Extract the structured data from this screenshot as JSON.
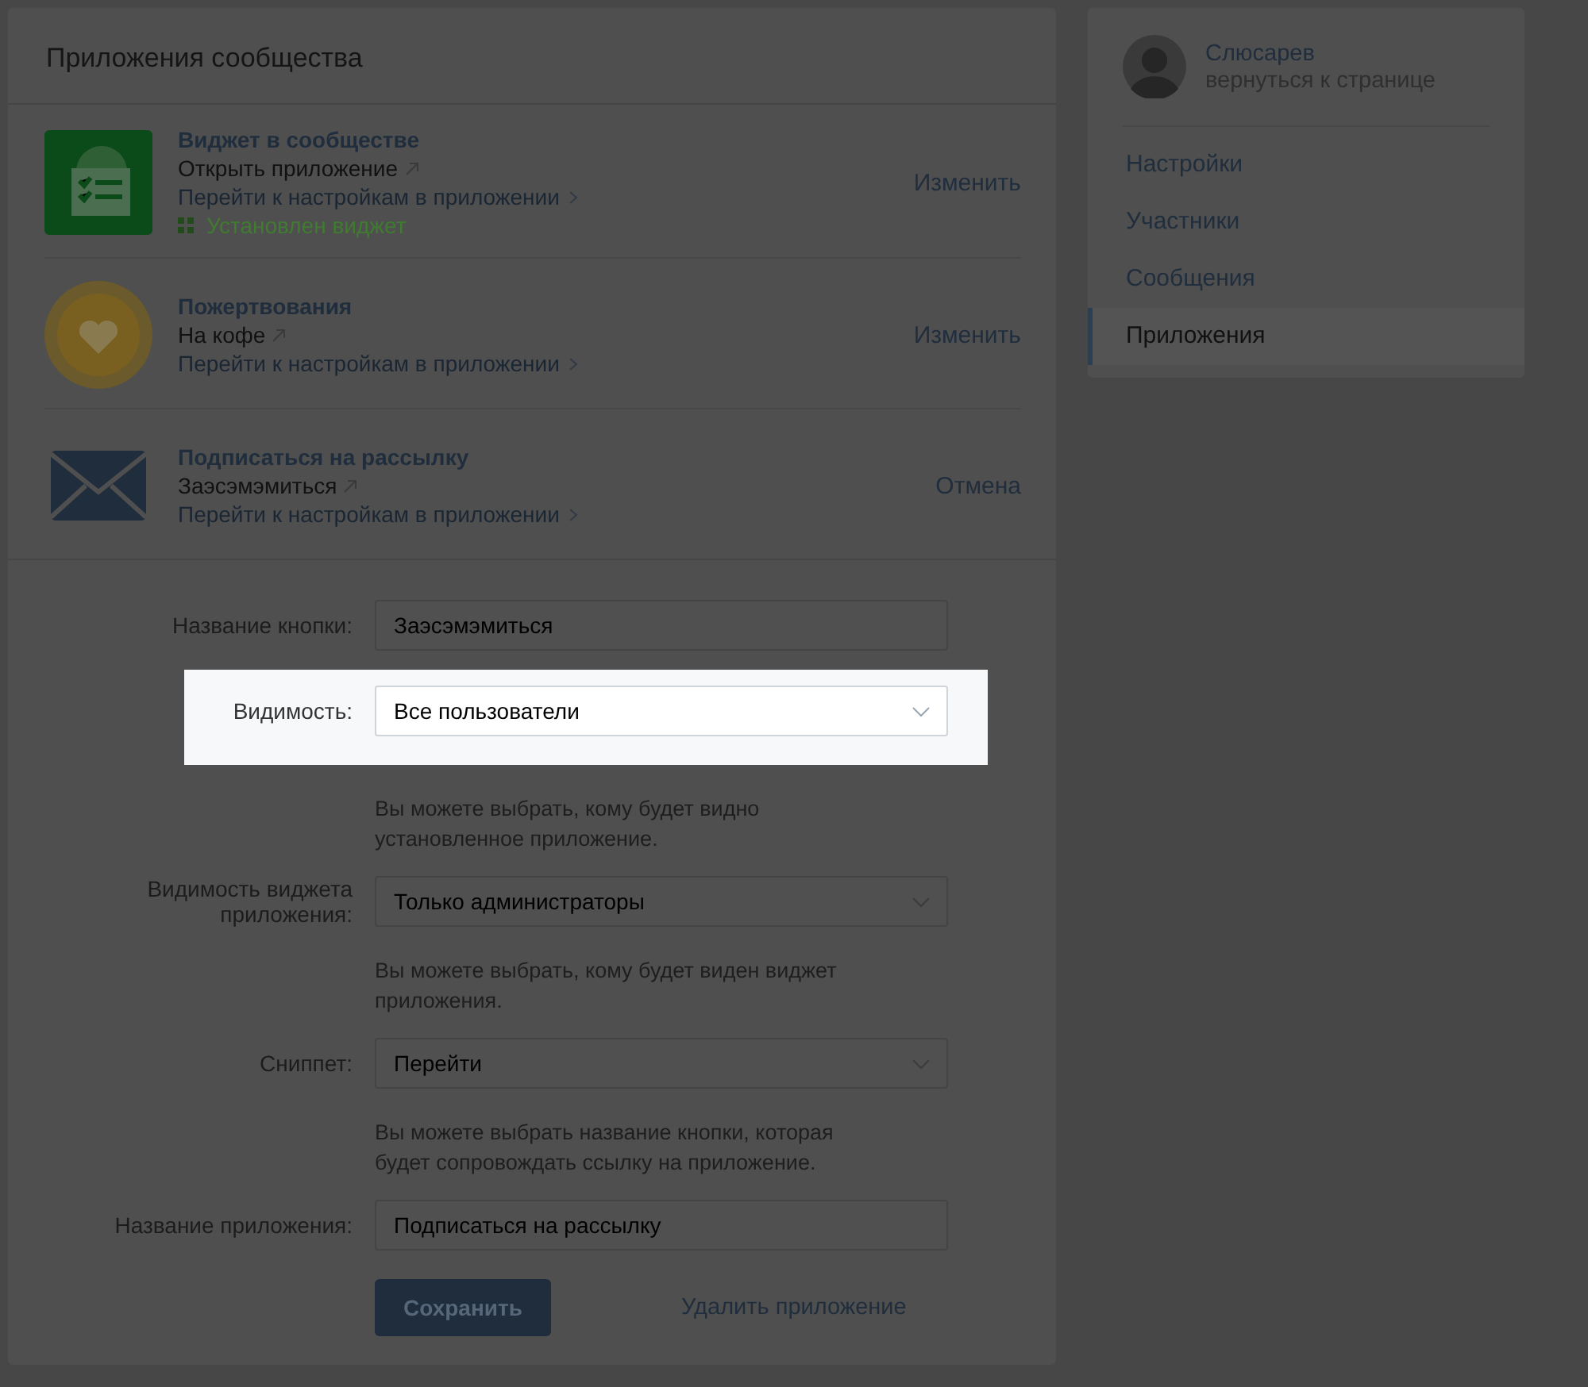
{
  "page": {
    "title": "Приложения сообщества"
  },
  "apps": [
    {
      "kind": "widget",
      "name": "Виджет в сообществе",
      "open_link": "Открыть приложение",
      "settings_link": "Перейти к настройкам в приложении",
      "status": "Установлен виджет",
      "action": "Изменить"
    },
    {
      "kind": "donation",
      "name": "Пожертвования",
      "open_link": "На кофе",
      "settings_link": "Перейти к настройкам в приложении",
      "action": "Изменить"
    },
    {
      "kind": "mail",
      "name": "Подписаться на рассылку",
      "open_link": "Заэсэмэмиться",
      "settings_link": "Перейти к настройкам в приложении",
      "action": "Отмена"
    }
  ],
  "form": {
    "fields": [
      {
        "kind": "input",
        "label": "Название кнопки:",
        "value": "Заэсэмэмиться",
        "highlighted": false
      },
      {
        "kind": "select",
        "label": "Видимость:",
        "value": "Все пользователи",
        "hint": "Вы можете выбрать, кому будет видно установленное приложение.",
        "highlighted": true
      },
      {
        "kind": "select",
        "label": "Видимость виджета приложения:",
        "value": "Только администраторы",
        "hint": "Вы можете выбрать, кому будет виден виджет приложения.",
        "highlighted": false
      },
      {
        "kind": "select",
        "label": "Сниппет:",
        "value": "Перейти",
        "hint": "Вы можете выбрать название кнопки, которая будет сопровождать ссылку на приложение.",
        "highlighted": false
      },
      {
        "kind": "input",
        "label": "Название приложения:",
        "value": "Подписаться на рассылку",
        "highlighted": false
      }
    ],
    "save_button": "Сохранить",
    "delete_link": "Удалить приложение"
  },
  "sidebar": {
    "profile": {
      "name": "Слюсарев",
      "link": "вернуться к странице"
    },
    "items": [
      {
        "label": "Настройки",
        "selected": false
      },
      {
        "label": "Участники",
        "selected": false
      },
      {
        "label": "Сообщения",
        "selected": false
      },
      {
        "label": "Приложения",
        "selected": true
      }
    ]
  }
}
